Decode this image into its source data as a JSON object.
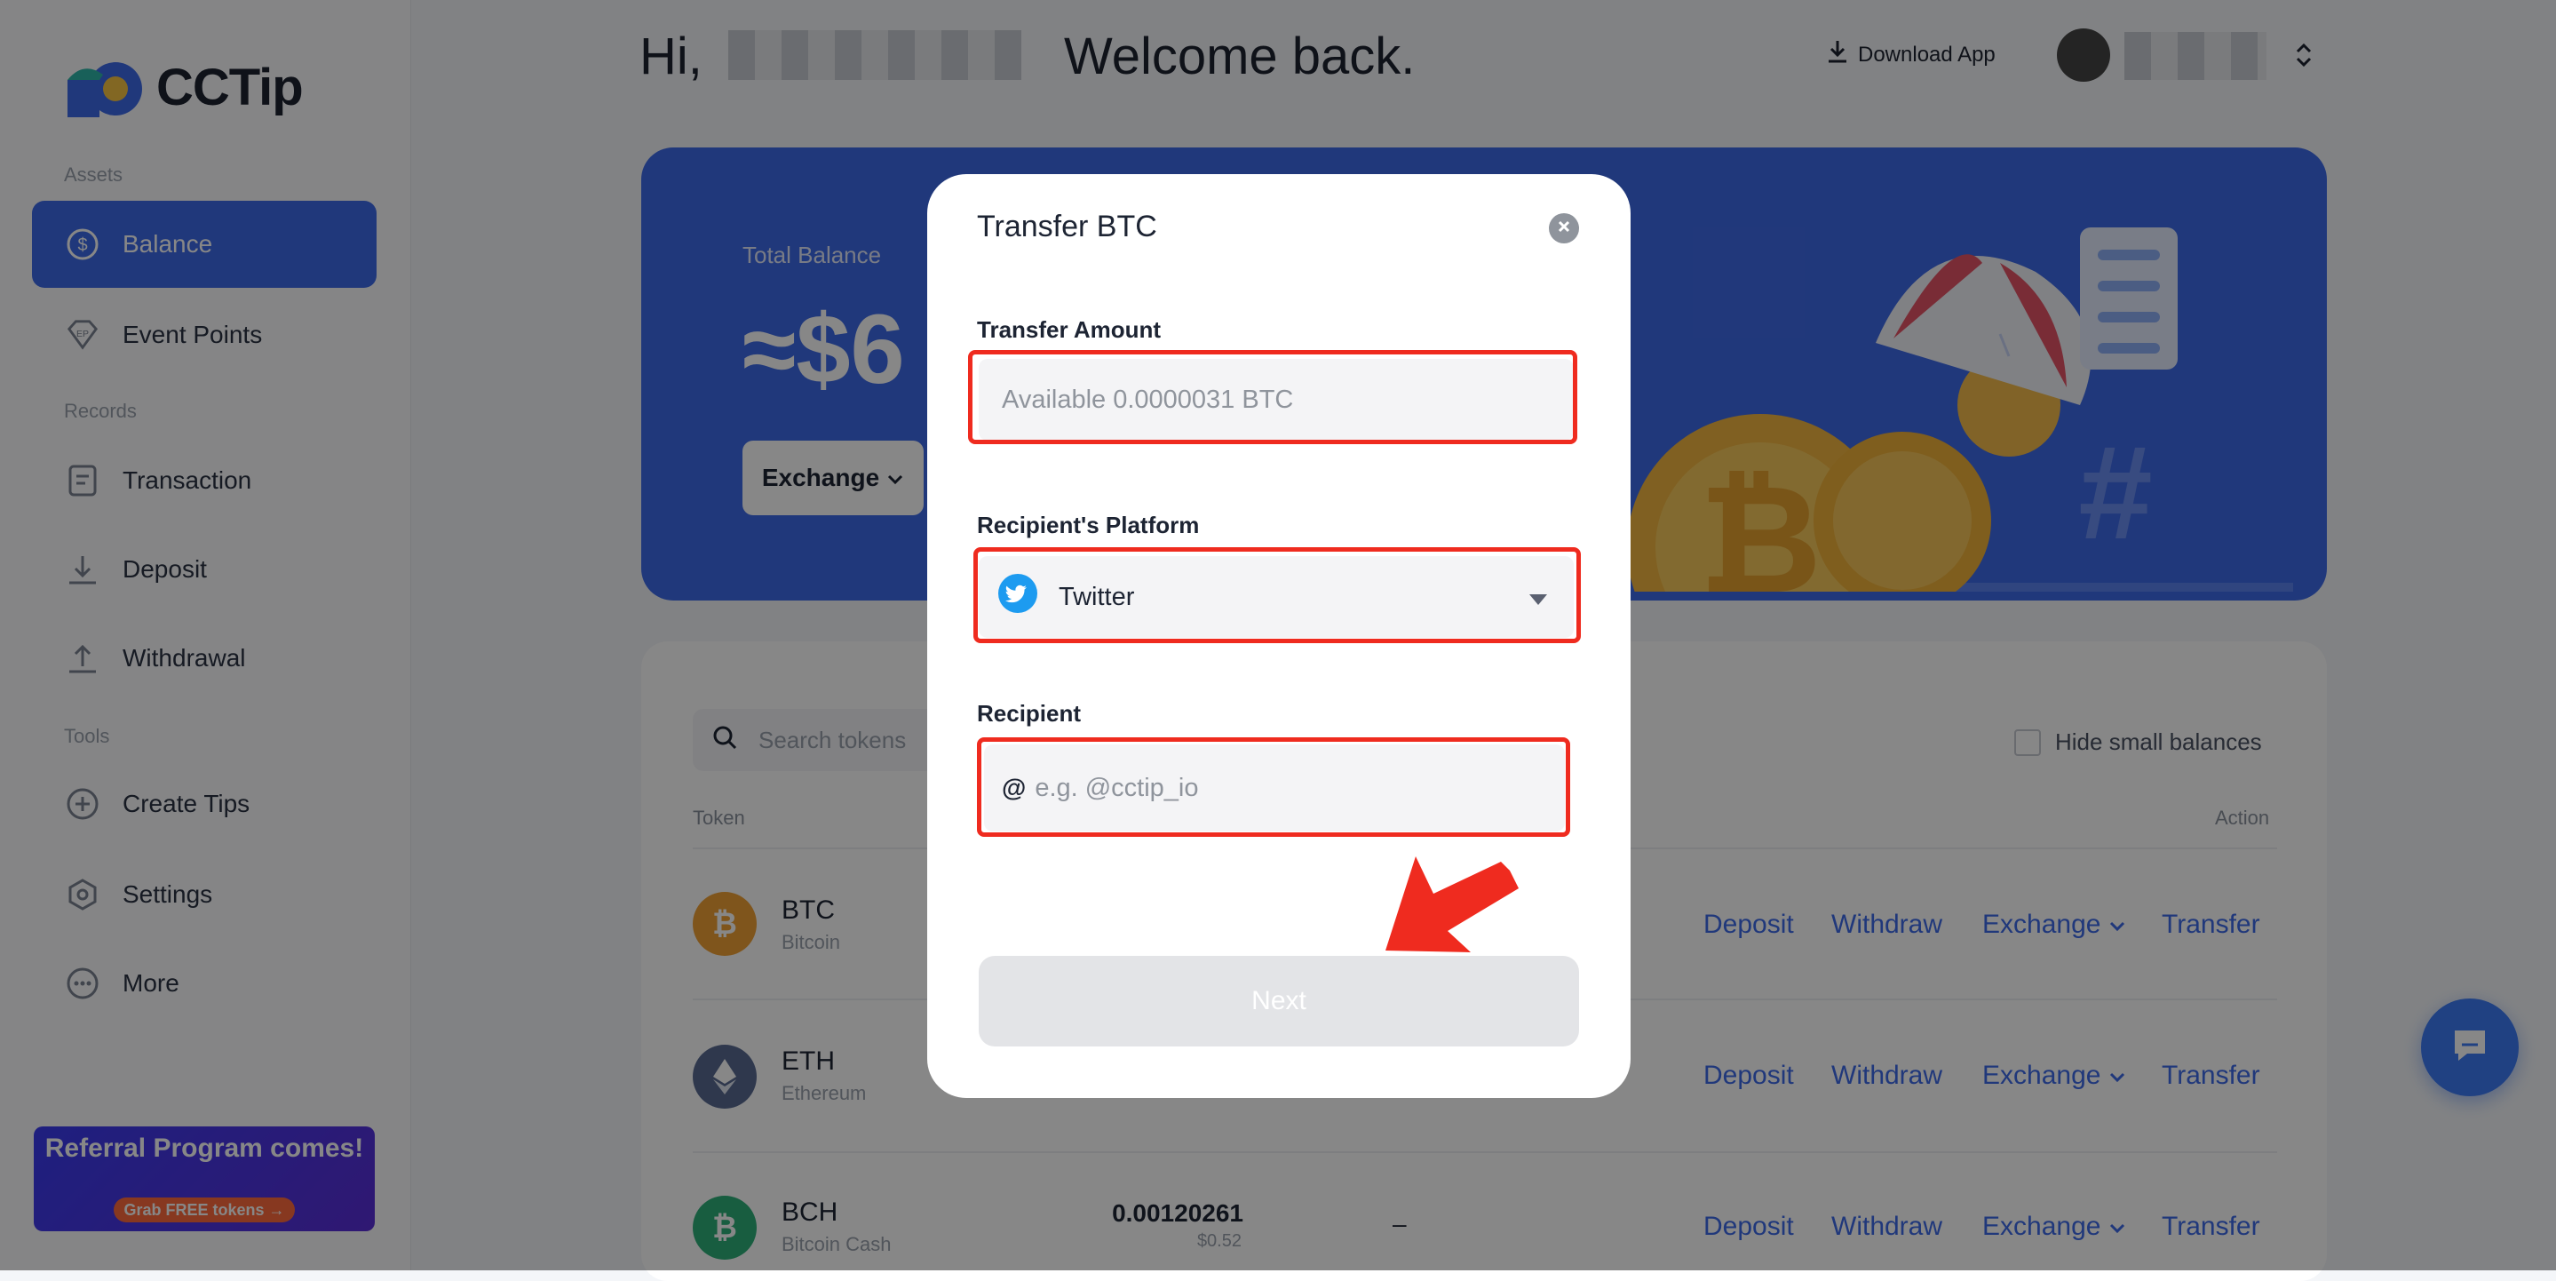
{
  "app": {
    "logo_text": "CCTip"
  },
  "sidebar": {
    "sections": {
      "assets": "Assets",
      "records": "Records",
      "tools": "Tools"
    },
    "items": [
      {
        "label": "Balance",
        "icon": "dollar-circle-icon"
      },
      {
        "label": "Event Points",
        "icon": "ep-gem-icon"
      },
      {
        "label": "Transaction",
        "icon": "document-icon"
      },
      {
        "label": "Deposit",
        "icon": "download-icon"
      },
      {
        "label": "Withdrawal",
        "icon": "upload-icon"
      },
      {
        "label": "Create Tips",
        "icon": "plus-circle-icon"
      },
      {
        "label": "Settings",
        "icon": "hexagon-gear-icon"
      },
      {
        "label": "More",
        "icon": "more-dots-icon"
      }
    ],
    "referral": {
      "title": "Referral Program comes!",
      "button": "Grab FREE tokens →"
    }
  },
  "header": {
    "greeting_hi": "Hi,",
    "greeting_welcome": "Welcome back.",
    "download_app": "Download App"
  },
  "banner": {
    "total_label": "Total Balance",
    "total_value": "≈$6",
    "exchange_button": "Exchange"
  },
  "tokens_table": {
    "search_placeholder": "Search tokens",
    "hide_small_label": "Hide small balances",
    "col_token": "Token",
    "col_action": "Action",
    "rows": [
      {
        "symbol": "BTC",
        "name": "Bitcoin",
        "amount": "",
        "amount_usd": "",
        "extra": "",
        "color": "#f0a035"
      },
      {
        "symbol": "ETH",
        "name": "Ethereum",
        "amount": "",
        "amount_usd": "",
        "extra": "",
        "color": "#5a6b92"
      },
      {
        "symbol": "BCH",
        "name": "Bitcoin Cash",
        "amount": "0.00120261",
        "amount_usd": "$0.52",
        "extra": "–",
        "color": "#2fb07a"
      }
    ],
    "actions": {
      "deposit": "Deposit",
      "withdraw": "Withdraw",
      "exchange": "Exchange",
      "transfer": "Transfer"
    }
  },
  "modal": {
    "title": "Transfer BTC",
    "amount_label": "Transfer Amount",
    "amount_placeholder": "Available 0.0000031 BTC",
    "platform_label": "Recipient's Platform",
    "platform_value": "Twitter",
    "recipient_label": "Recipient",
    "recipient_prefix": "@",
    "recipient_placeholder": "e.g. @cctip_io",
    "next_button": "Next"
  },
  "colors": {
    "brand_blue": "#3e6ae8",
    "highlight_red": "#ef2b1f",
    "twitter_blue": "#1d9bf0"
  }
}
